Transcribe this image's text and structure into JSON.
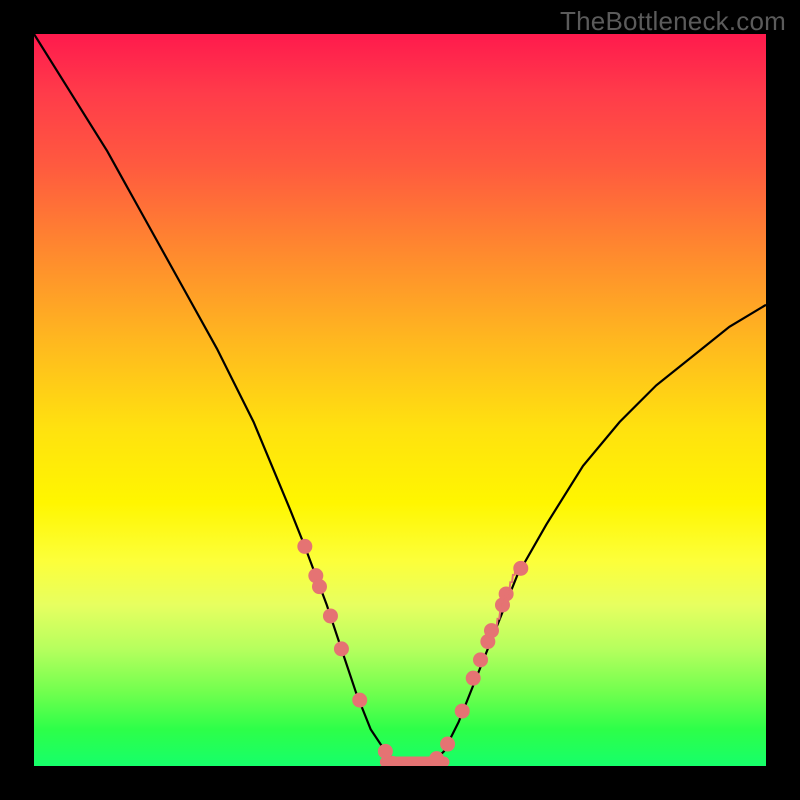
{
  "watermark": "TheBottleneck.com",
  "chart_data": {
    "type": "line",
    "title": "",
    "xlabel": "",
    "ylabel": "",
    "ylim": [
      0,
      100
    ],
    "xlim": [
      0,
      100
    ],
    "series": [
      {
        "name": "bottleneck-curve",
        "x": [
          0,
          5,
          10,
          15,
          20,
          25,
          30,
          35,
          37,
          40,
          42,
          44,
          46,
          48,
          50,
          52,
          54,
          56,
          58,
          62,
          66,
          70,
          75,
          80,
          85,
          90,
          95,
          100
        ],
        "y": [
          100,
          92,
          84,
          75,
          66,
          57,
          47,
          35,
          30,
          22,
          16,
          10,
          5,
          2,
          0,
          0,
          0,
          2,
          6,
          16,
          26,
          33,
          41,
          47,
          52,
          56,
          60,
          63
        ]
      }
    ],
    "markers": {
      "name": "highlighted-points",
      "color": "#e57373",
      "points": [
        {
          "x": 37,
          "y": 30
        },
        {
          "x": 38.5,
          "y": 26
        },
        {
          "x": 39,
          "y": 24.5
        },
        {
          "x": 40.5,
          "y": 20.5
        },
        {
          "x": 42,
          "y": 16
        },
        {
          "x": 44.5,
          "y": 9
        },
        {
          "x": 48,
          "y": 2
        },
        {
          "x": 49,
          "y": 0.5
        },
        {
          "x": 51,
          "y": 0
        },
        {
          "x": 53,
          "y": 0
        },
        {
          "x": 55,
          "y": 1
        },
        {
          "x": 56.5,
          "y": 3
        },
        {
          "x": 58.5,
          "y": 7.5
        },
        {
          "x": 60,
          "y": 12
        },
        {
          "x": 61,
          "y": 14.5
        },
        {
          "x": 62,
          "y": 17
        },
        {
          "x": 62.5,
          "y": 18.5
        },
        {
          "x": 64,
          "y": 22
        },
        {
          "x": 64.5,
          "y": 23.5
        },
        {
          "x": 66.5,
          "y": 27
        }
      ]
    },
    "flat_bottom_segment": {
      "x_start": 48,
      "x_end": 56,
      "y": 0,
      "color": "#e57373"
    }
  }
}
